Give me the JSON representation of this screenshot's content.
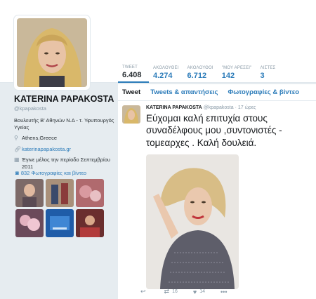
{
  "profile": {
    "name": "KATERINA PAPAKOSTA",
    "handle": "@kpapakosta",
    "bio": "Βουλευτής Β' Αθηνών Ν.Δ - τ. Υφυπουργός Υγείας",
    "location": "Athens,Greece",
    "website": "katerinapapakosta.gr",
    "joined": "Έγινε μέλος την περίοδο Σεπτεμβρίου 2011",
    "photos_link": "832 Φωτογραφίες και βίντεο"
  },
  "stats": [
    {
      "label": "TWEET",
      "value": "6.408"
    },
    {
      "label": "ΑΚΟΛΟΥΘΕΙ",
      "value": "4.274"
    },
    {
      "label": "ΑΚΟΛΟΥΘΟΙ",
      "value": "6.712"
    },
    {
      "label": "\"ΜΟΥ ΑΡΕΣΕΙ\"",
      "value": "142"
    },
    {
      "label": "ΛΙΣΤΕΣ",
      "value": "3"
    }
  ],
  "tabs": [
    {
      "label": "Tweet"
    },
    {
      "label": "Tweets & απαντήσεις"
    },
    {
      "label": "Φωτογραφίες & βίντεο"
    }
  ],
  "tweet": {
    "name": "KATERINA PAPAKOSTA",
    "handle": "@kpapakosta",
    "time": "17 ώρες",
    "text": "Εύχομαι καλή επιτυχία στους συναδέλφους μου ,συντονιστές - τομεαρχες . Καλή δουλειά.",
    "retweets": "16",
    "likes": "14"
  },
  "icons": {
    "location": "map-pin-icon",
    "website": "link-icon",
    "joined": "calendar-icon",
    "photos": "camera-icon",
    "reply": "reply-icon",
    "retweet": "retweet-icon",
    "like": "heart-icon",
    "more": "more-icon"
  },
  "colors": {
    "accent": "#2b7bb9",
    "page_bg": "#e6ecf0",
    "muted": "#8899a6"
  }
}
